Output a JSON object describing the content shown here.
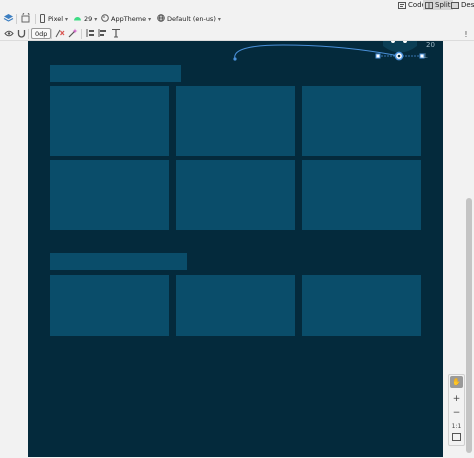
{
  "view_modes": {
    "code": "Code",
    "split": "Split",
    "design": "Desi"
  },
  "toolbar": {
    "device": "Pixel",
    "api_level": "29",
    "theme": "AppTheme",
    "locale": "Default (en-us)",
    "margin": "0dp"
  },
  "constraint_widget": {
    "value": "20"
  },
  "zoom": {
    "fit_label": "1:1"
  },
  "colors": {
    "canvas": "#042a3c",
    "placeholder": "#0a4d6a",
    "selection": "#4a90d9"
  },
  "icons": {
    "layers": "layers-icon",
    "orientation": "rotate-icon",
    "phone": "phone-icon",
    "android": "android-icon",
    "theme": "palette-icon",
    "globe": "globe-icon",
    "eye": "eye-icon",
    "magnet": "magnet-icon",
    "infer": "wand-icon",
    "pack": "pack-icon",
    "align": "align-icon",
    "guideline": "guideline-icon",
    "hand": "hand-icon"
  }
}
